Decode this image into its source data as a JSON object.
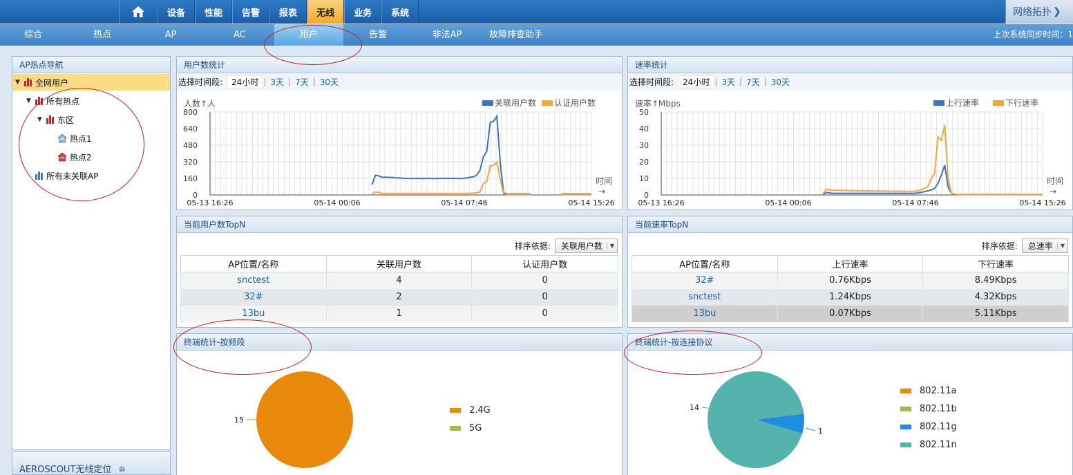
{
  "topnav": {
    "items": [
      "设备",
      "性能",
      "告警",
      "报表",
      "无线",
      "业务",
      "系统"
    ],
    "active": "无线",
    "topology_label": "网络拓扑"
  },
  "subnav": {
    "items": [
      "综合",
      "热点",
      "AP",
      "AC",
      "用户",
      "告警",
      "非法AP",
      "故障排查助手"
    ],
    "active": "用户",
    "sync_label": "上次系统同步时间：1"
  },
  "left": {
    "title": "AP热点导航",
    "tree": [
      {
        "label": "全网用户",
        "level": 0,
        "selected": true
      },
      {
        "label": "所有热点",
        "level": 1
      },
      {
        "label": "东区",
        "level": 2
      },
      {
        "label": "热点1",
        "level": 3
      },
      {
        "label": "热点2",
        "level": 3
      },
      {
        "label": "所有未关联AP",
        "level": 1
      }
    ],
    "aeroscout": "AEROSCOUT无线定位"
  },
  "user_stats": {
    "title": "用户数统计",
    "time_label": "选择时间段:",
    "time_options": [
      "24小时",
      "3天",
      "7天",
      "30天"
    ],
    "selected_time": "24小时"
  },
  "rate_stats": {
    "title": "速率统计",
    "time_label": "选择时间段:",
    "time_options": [
      "24小时",
      "3天",
      "7天",
      "30天"
    ],
    "selected_time": "24小时"
  },
  "user_topn": {
    "title": "当前用户数TopN",
    "sort_label": "排序依据:",
    "sort_value": "关联用户数",
    "columns": [
      "AP位置/名称",
      "关联用户数",
      "认证用户数"
    ],
    "rows": [
      [
        "snctest",
        "4",
        "0"
      ],
      [
        "32#",
        "2",
        "0"
      ],
      [
        "13bu",
        "1",
        "0"
      ]
    ]
  },
  "rate_topn": {
    "title": "当前速率TopN",
    "sort_label": "排序依据:",
    "sort_value": "总速率",
    "columns": [
      "AP位置/名称",
      "上行速率",
      "下行速率"
    ],
    "rows": [
      [
        "32#",
        "0.76Kbps",
        "8.49Kbps"
      ],
      [
        "snctest",
        "1.24Kbps",
        "4.32Kbps"
      ],
      [
        "13bu",
        "0.07Kbps",
        "5.11Kbps"
      ]
    ]
  },
  "band_stats": {
    "title": "终端统计-按频段"
  },
  "proto_stats": {
    "title": "终端统计-按连接协议"
  },
  "chart_data": [
    {
      "type": "line",
      "ylabel": "人数↑人",
      "xlabel": "时间",
      "ylim": [
        0,
        800
      ],
      "yticks": [
        0,
        160,
        320,
        480,
        640,
        800
      ],
      "xtick_labels": [
        "05-13 16:26",
        "05-14 00:06",
        "05-14 07:46",
        "05-14 15:26"
      ],
      "series": [
        {
          "name": "关联用户数",
          "color": "#3a72c8",
          "values": [
            null,
            null,
            null,
            null,
            null,
            null,
            null,
            null,
            null,
            null,
            null,
            null,
            null,
            null,
            null,
            null,
            null,
            null,
            null,
            null,
            null,
            null,
            null,
            null,
            null,
            null,
            null,
            null,
            null,
            null,
            null,
            null,
            null,
            null,
            null,
            null,
            null,
            null,
            null,
            null,
            null,
            null,
            null,
            null,
            null,
            null,
            null,
            null,
            100,
            190,
            185,
            170,
            172,
            168,
            170,
            165,
            165,
            162,
            160,
            160,
            158,
            160,
            160,
            158,
            160,
            160,
            158,
            160,
            160,
            160,
            162,
            160,
            160,
            160,
            158,
            160,
            165,
            170,
            175,
            190,
            240,
            370,
            420,
            700,
            710,
            760,
            300,
            20,
            10,
            10,
            10,
            10,
            10,
            10,
            10,
            10,
            null,
            null,
            null,
            null,
            null,
            null,
            null,
            null,
            10,
            10,
            10,
            10,
            10,
            10,
            10,
            10,
            10,
            10
          ]
        },
        {
          "name": "认证用户数",
          "color": "#f4a63a",
          "values": [
            null,
            null,
            null,
            null,
            null,
            null,
            null,
            null,
            null,
            null,
            null,
            null,
            null,
            null,
            null,
            null,
            null,
            null,
            null,
            null,
            null,
            null,
            null,
            null,
            null,
            null,
            null,
            null,
            null,
            null,
            null,
            null,
            null,
            null,
            null,
            null,
            null,
            null,
            null,
            null,
            null,
            null,
            null,
            null,
            null,
            null,
            null,
            null,
            10,
            30,
            25,
            15,
            15,
            14,
            15,
            14,
            14,
            14,
            14,
            14,
            14,
            14,
            14,
            14,
            14,
            14,
            14,
            14,
            14,
            14,
            15,
            14,
            14,
            14,
            14,
            14,
            15,
            16,
            18,
            20,
            30,
            110,
            130,
            280,
            285,
            320,
            150,
            10,
            5,
            5,
            5,
            5,
            5,
            5,
            5,
            5,
            null,
            null,
            null,
            null,
            null,
            null,
            null,
            null,
            5,
            5,
            5,
            5,
            5,
            5,
            5,
            5,
            5,
            5
          ]
        }
      ]
    },
    {
      "type": "line",
      "ylabel": "速率↑Mbps",
      "xlabel": "时间",
      "ylim": [
        0,
        50
      ],
      "yticks": [
        0,
        10,
        20,
        30,
        40,
        50
      ],
      "xtick_labels": [
        "05-13 16:26",
        "05-14 00:06",
        "05-14 07:46",
        "05-14 15:26"
      ],
      "series": [
        {
          "name": "上行速率",
          "color": "#3a72c8",
          "values": [
            null,
            null,
            null,
            null,
            null,
            null,
            null,
            null,
            null,
            null,
            null,
            null,
            null,
            null,
            null,
            null,
            null,
            null,
            null,
            null,
            null,
            null,
            null,
            null,
            null,
            null,
            null,
            null,
            null,
            null,
            null,
            null,
            null,
            null,
            null,
            null,
            null,
            null,
            null,
            null,
            null,
            null,
            null,
            null,
            null,
            null,
            null,
            null,
            0.5,
            1.5,
            1.2,
            1,
            1,
            1,
            1,
            1,
            1,
            1,
            1,
            1,
            1,
            1,
            1,
            1,
            1,
            1,
            1,
            1,
            1,
            1,
            1,
            1,
            1,
            1,
            1,
            1,
            1.2,
            1.5,
            2,
            2.5,
            3,
            4,
            7,
            12,
            18,
            5,
            1,
            0.5,
            0.3,
            0.3,
            0.3,
            0.3,
            0.3,
            0.3,
            0.3,
            0.3,
            0.3,
            0.3,
            0.3,
            0.3,
            0.3,
            0.3,
            0.3,
            0.3,
            0.3,
            0.3,
            0.3,
            0.3,
            0.3,
            0.3,
            0.3,
            0.3,
            0.3,
            0.3
          ]
        },
        {
          "name": "下行速率",
          "color": "#f4a63a",
          "values": [
            null,
            null,
            null,
            null,
            null,
            null,
            null,
            null,
            null,
            null,
            null,
            null,
            null,
            null,
            null,
            null,
            null,
            null,
            null,
            null,
            null,
            null,
            null,
            null,
            null,
            null,
            null,
            null,
            null,
            null,
            null,
            null,
            null,
            null,
            null,
            null,
            null,
            null,
            null,
            null,
            null,
            null,
            null,
            null,
            null,
            null,
            null,
            null,
            1,
            3.5,
            3,
            2.8,
            2.8,
            2.7,
            2.7,
            2.7,
            2.6,
            2.6,
            2.5,
            2.5,
            2.5,
            2.5,
            2.5,
            2.4,
            2.4,
            2.4,
            2.4,
            2.3,
            2.3,
            2.3,
            2.3,
            2.2,
            2.2,
            2.2,
            2.2,
            2.2,
            2.5,
            3,
            4,
            5,
            10,
            13,
            35,
            33,
            42,
            10,
            1,
            0.5,
            0.3,
            0.3,
            0.3,
            0.3,
            0.3,
            0.3,
            0.3,
            0.3,
            0.3,
            0.3,
            0.3,
            0.3,
            0.3,
            0.3,
            0.3,
            0.3,
            0.3,
            0.3,
            0.3,
            0.3,
            0.3,
            0.3,
            0.3,
            0.3,
            0.3,
            0.3
          ]
        }
      ]
    },
    {
      "type": "pie",
      "labels": [
        "2.4G",
        "5G"
      ],
      "values": [
        15,
        0
      ],
      "colors": [
        "#e8890b",
        "#a8b84a"
      ]
    },
    {
      "type": "pie",
      "labels": [
        "802.11a",
        "802.11b",
        "802.11g",
        "802.11n"
      ],
      "values": [
        0,
        0,
        1,
        14
      ],
      "colors": [
        "#e8890b",
        "#a8b84a",
        "#1d8ee0",
        "#54b4ad"
      ]
    }
  ]
}
